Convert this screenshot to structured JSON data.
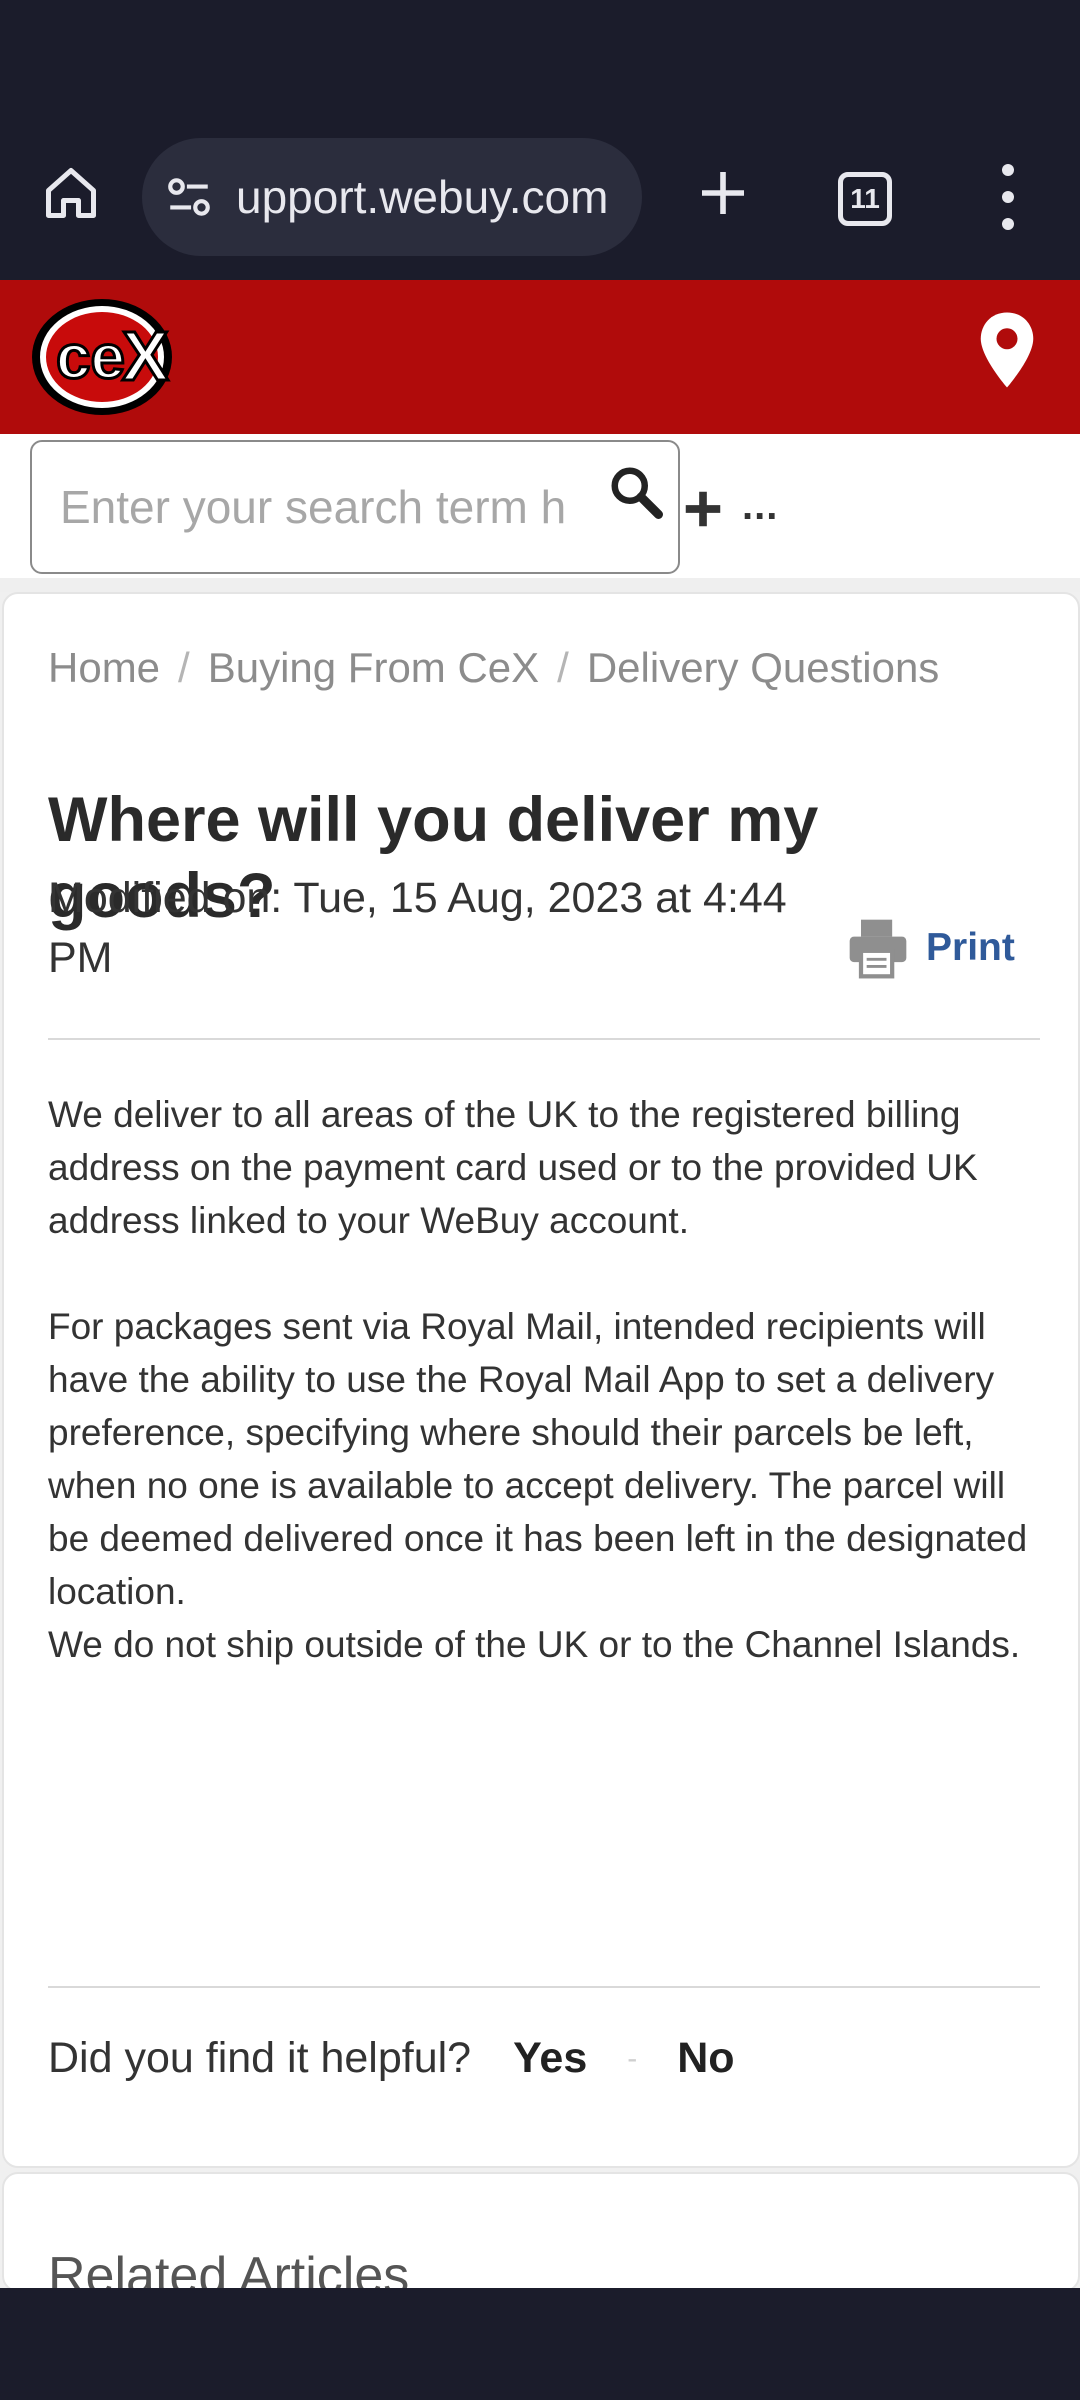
{
  "browser": {
    "url": "upport.webuy.com",
    "tab_count": "11"
  },
  "site": {
    "brand_color": "#b00b0b",
    "logo_text": "cex"
  },
  "search": {
    "placeholder": "Enter your search term h",
    "more_label": "..."
  },
  "breadcrumb": {
    "home": "Home",
    "section": "Buying From CeX",
    "category": "Delivery Questions",
    "separator": "/"
  },
  "article": {
    "title": "Where will you deliver my goods?",
    "modified": "Modified on: Tue, 15 Aug, 2023 at 4:44 PM",
    "print_label": "Print",
    "paragraphs": [
      "We deliver to all areas of the UK to the registered billing address on the payment card used or to the provided UK address linked to your WeBuy account.",
      "For packages sent via Royal Mail, intended recipients will have the ability to use the Royal Mail App to set a delivery preference, specifying where should their parcels be left, when no one is available to accept delivery. The parcel will be deemed delivered once it has been left in the designated location.",
      "We do not ship outside of the UK or to the Channel Islands."
    ]
  },
  "feedback": {
    "question": "Did you find it helpful?",
    "yes": "Yes",
    "separator": "-",
    "no": "No"
  },
  "related": {
    "title": "Related Articles"
  }
}
